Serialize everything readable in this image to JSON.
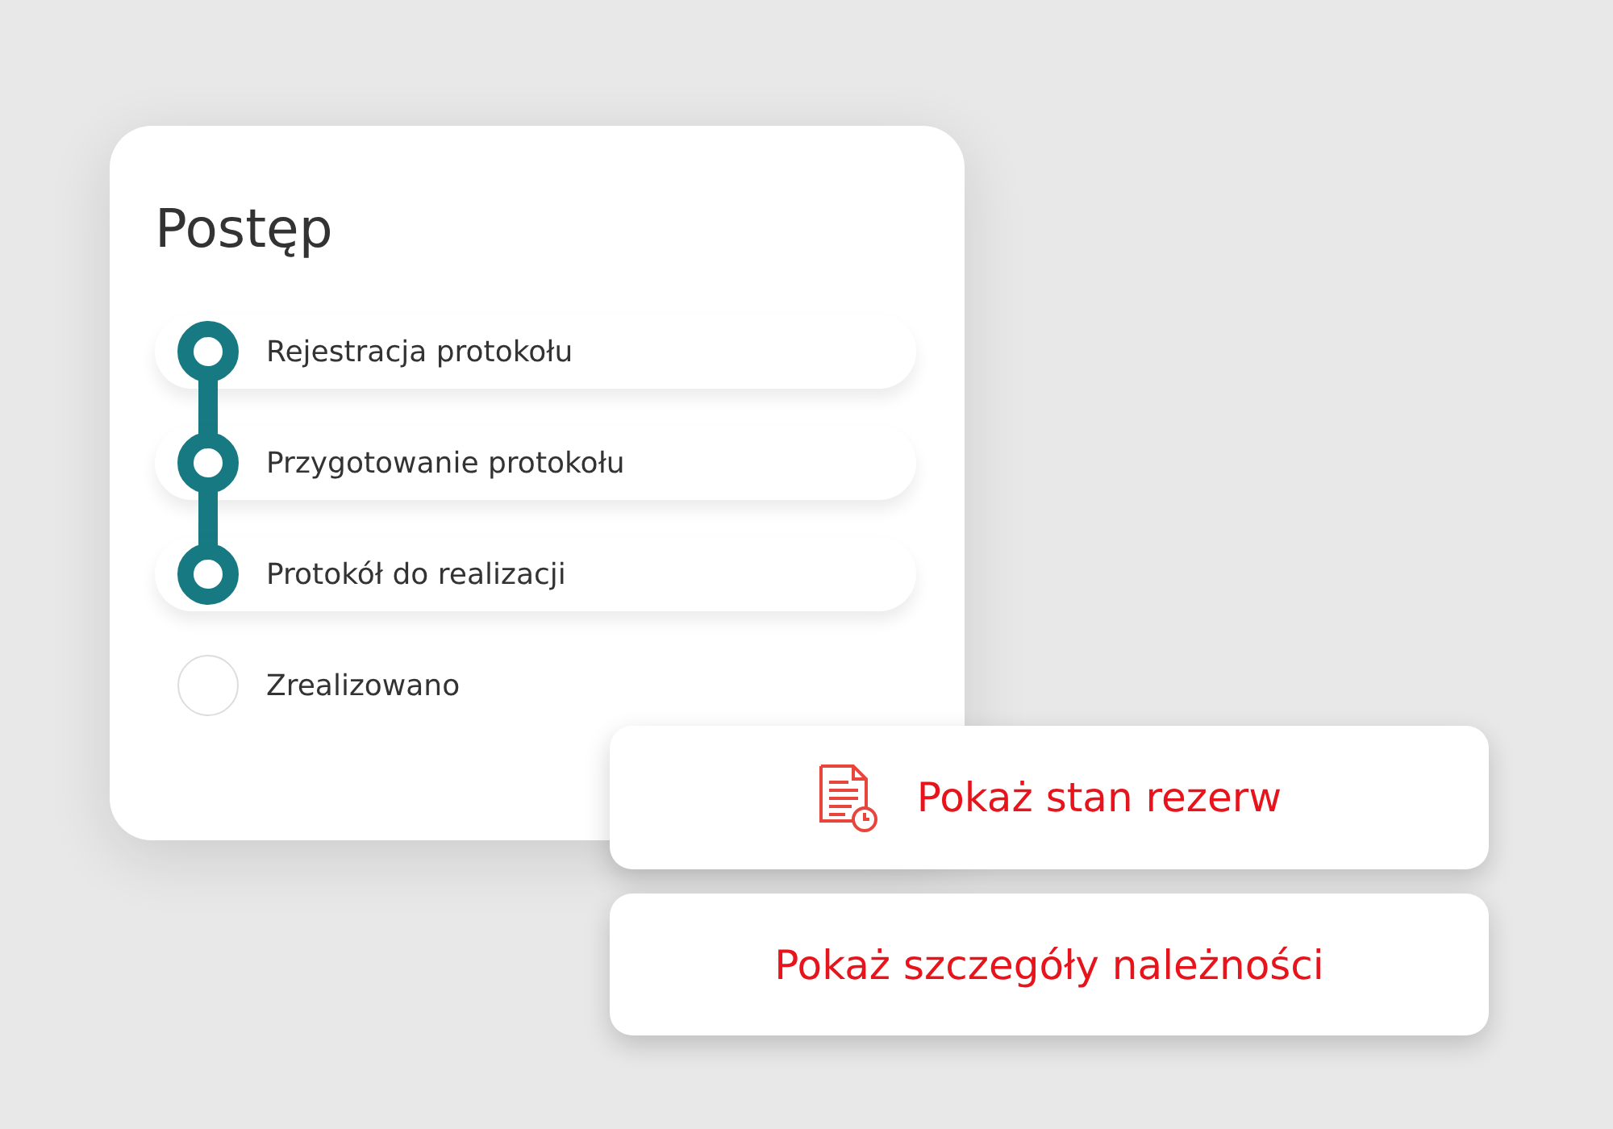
{
  "card": {
    "title": "Postęp",
    "steps": [
      {
        "label": "Rejestracja protokołu",
        "done": true
      },
      {
        "label": "Przygotowanie protokołu",
        "done": true
      },
      {
        "label": "Protokół do realizacji",
        "done": true
      },
      {
        "label": "Zrealizowano",
        "done": false
      }
    ]
  },
  "actions": [
    {
      "label": "Pokaż stan rezerw",
      "has_icon": true
    },
    {
      "label": "Pokaż szczegóły należności",
      "has_icon": false
    }
  ]
}
